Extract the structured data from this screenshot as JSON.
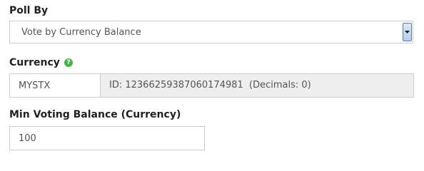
{
  "poll_by": {
    "label": "Poll By",
    "selected": "Vote by Currency Balance"
  },
  "currency": {
    "label": "Currency",
    "help_icon": "?",
    "value": "MYSTX",
    "info": "ID: 12366259387060174981  (Decimals: 0)"
  },
  "min_voting_balance": {
    "label": "Min Voting Balance (Currency)",
    "value": "100"
  },
  "colors": {
    "help_icon": "#4caf50",
    "readonly_bg": "#eeeeee",
    "border": "#cccccc"
  }
}
